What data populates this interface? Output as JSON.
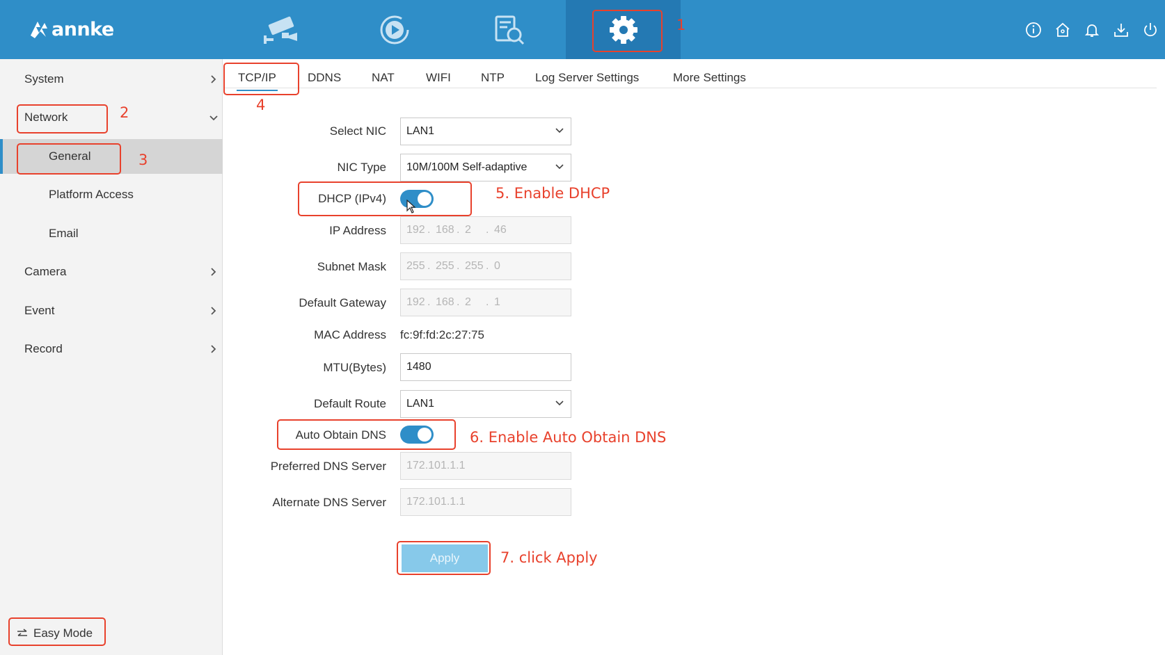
{
  "brand": {
    "logo_text": "annke"
  },
  "top_nav": {
    "icons": [
      "camera-live-view-icon",
      "playback-icon",
      "search-icon",
      "settings-gear-icon"
    ],
    "active": "settings-gear-icon",
    "right_icons": [
      "info-icon",
      "home-icon",
      "bell-icon",
      "download-icon",
      "power-icon"
    ]
  },
  "sidebar": {
    "items": [
      {
        "label": "System"
      },
      {
        "label": "Network"
      },
      {
        "label": "General"
      },
      {
        "label": "Platform Access"
      },
      {
        "label": "Email"
      },
      {
        "label": "Camera"
      },
      {
        "label": "Event"
      },
      {
        "label": "Record"
      }
    ],
    "active": "General",
    "easy_mode": "Easy Mode"
  },
  "tabs": [
    "TCP/IP",
    "DDNS",
    "NAT",
    "WIFI",
    "NTP",
    "Log Server Settings",
    "More Settings"
  ],
  "active_tab": "TCP/IP",
  "form": {
    "select_nic": {
      "label": "Select NIC",
      "value": "LAN1"
    },
    "nic_type": {
      "label": "NIC Type",
      "value": "10M/100M Self-adaptive"
    },
    "dhcp": {
      "label": "DHCP (IPv4)",
      "enabled": true
    },
    "ip_address": {
      "label": "IP Address",
      "octets": [
        "192",
        "168",
        "2",
        "46"
      ]
    },
    "subnet_mask": {
      "label": "Subnet Mask",
      "octets": [
        "255",
        "255",
        "255",
        "0"
      ]
    },
    "default_gateway": {
      "label": "Default Gateway",
      "octets": [
        "192",
        "168",
        "2",
        "1"
      ]
    },
    "mac_address": {
      "label": "MAC Address",
      "value": "fc:9f:fd:2c:27:75"
    },
    "mtu": {
      "label": "MTU(Bytes)",
      "value": "1480"
    },
    "default_route": {
      "label": "Default Route",
      "value": "LAN1"
    },
    "auto_dns": {
      "label": "Auto Obtain DNS",
      "enabled": true
    },
    "preferred_dns": {
      "label": "Preferred DNS Server",
      "value": "172.101.1.1"
    },
    "alternate_dns": {
      "label": "Alternate DNS Server",
      "value": "172.101.1.1"
    },
    "apply_label": "Apply"
  },
  "annotations": {
    "n1": "1",
    "n2": "2",
    "n3": "3",
    "n4": "4",
    "n5": "5. Enable DHCP",
    "n6": "6. Enable Auto Obtain DNS",
    "n7": "7. click Apply"
  },
  "colors": {
    "accent": "#2f8ec8",
    "annotation": "#e8412c",
    "apply_disabled": "#87c9ea"
  }
}
